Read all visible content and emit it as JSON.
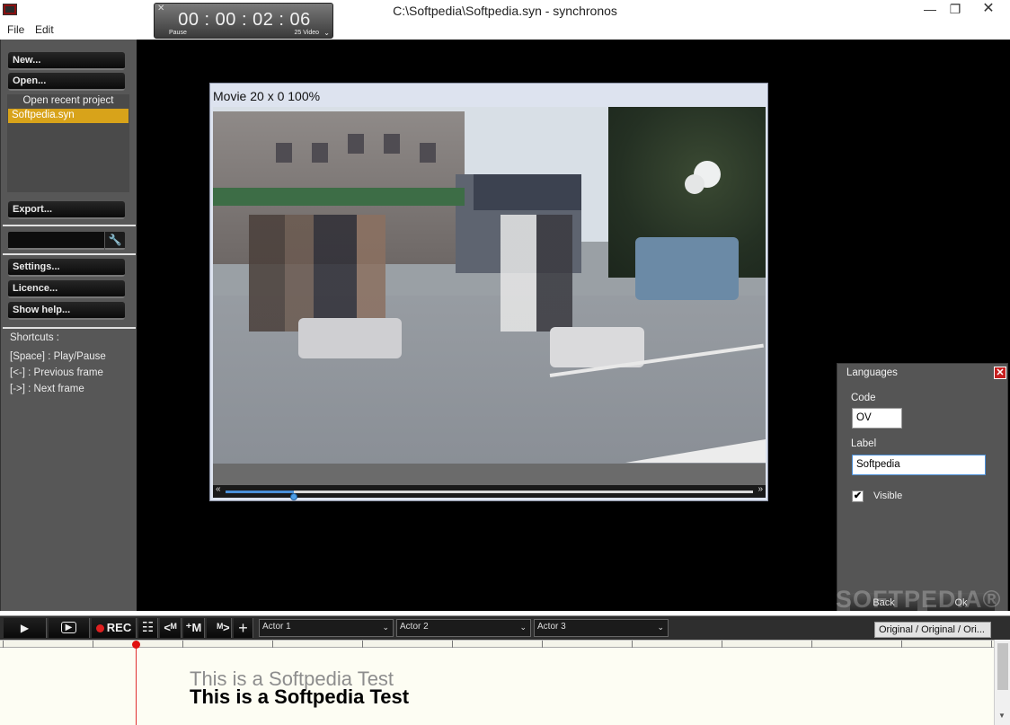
{
  "window": {
    "title": "C:\\Softpedia\\Softpedia.syn - synchronos",
    "minimize": "—",
    "maximize": "❐",
    "close": "✕"
  },
  "menu": {
    "file": "File",
    "edit": "Edit"
  },
  "timer": {
    "close": "✕",
    "value": "00 : 00 : 02 : 06",
    "state": "Pause",
    "fps": "25 Video",
    "chevron": "⌄"
  },
  "left": {
    "new": "New...",
    "open": "Open...",
    "recent_label": "Open recent project",
    "recent_items": [
      "Softpedia.syn"
    ],
    "export": "Export...",
    "tool_icon": "wrench-icon",
    "settings": "Settings...",
    "licence": "Licence...",
    "help": "Show help...",
    "shortcuts_title": "Shortcuts :",
    "shortcuts": [
      "[Space] : Play/Pause",
      "[<-] : Previous frame",
      "[->] : Next frame"
    ]
  },
  "movie": {
    "title": "Movie 20 x 0 100%",
    "prev": "«",
    "next": "»",
    "progress": 0.13
  },
  "dialog": {
    "title": "Languages",
    "close": "✕",
    "code_label": "Code",
    "code_value": "OV",
    "label_label": "Label",
    "label_value": "Softpedia",
    "visible_label": "Visible",
    "visible_checked": "✔",
    "back": "Back",
    "ok": "Ok"
  },
  "watermark": "SOFTPEDIA®",
  "toolbar": {
    "play": "▶",
    "play_frame": "▶",
    "rec": "REC",
    "list": "☷",
    "prev_marker": "<ᴹ",
    "add_marker": "⁺M",
    "marker_down": "M",
    "next_marker": "ᴹ>",
    "add": "+",
    "actors": [
      "Actor 1",
      "Actor 2",
      "Actor 3"
    ],
    "chevron": "⌄",
    "original": "Original / Original / Ori..."
  },
  "timeline": {
    "subtitle_preview": "This is a Softpedia Test",
    "subtitle_text": "This is a Softpedia Test"
  },
  "colors": {
    "accent_recent": "#d8a31a",
    "rec_red": "#e02020",
    "panel": "#575757"
  }
}
